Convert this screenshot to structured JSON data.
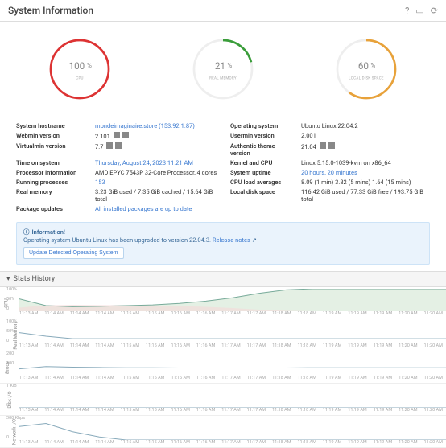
{
  "header": {
    "title": "System Information"
  },
  "gauges": [
    {
      "value": "100",
      "unit": "%",
      "label": "CPU",
      "color": "#d33",
      "pct": 100
    },
    {
      "value": "21",
      "unit": "%",
      "label": "REAL MEMORY",
      "color": "#3a9d3a",
      "pct": 21
    },
    {
      "value": "60",
      "unit": "%",
      "label": "LOCAL DISK SPACE",
      "color": "#e8a23a",
      "pct": 60
    }
  ],
  "info": {
    "hostname_lbl": "System hostname",
    "hostname": "mondeimaginaire.store (153.92.1.87)",
    "os_lbl": "Operating system",
    "os": "Ubuntu Linux 22.04.2",
    "webmin_lbl": "Webmin version",
    "webmin": "2.101",
    "usermin_lbl": "Usermin version",
    "usermin": "2.001",
    "virtualmin_lbl": "Virtualmin version",
    "virtualmin": "7.7",
    "theme_lbl": "Authentic theme version",
    "theme": "21.04",
    "time_lbl": "Time on system",
    "time": "Thursday, August 24, 2023 11:21 AM",
    "kernel_lbl": "Kernel and CPU",
    "kernel": "Linux 5.15.0-1039-kvm on x86_64",
    "proc_lbl": "Processor information",
    "proc": "AMD EPYC 7543P 32-Core Processor, 4 cores",
    "uptime_lbl": "System uptime",
    "uptime": "20 hours, 20 minutes",
    "running_lbl": "Running processes",
    "running": "153",
    "load_lbl": "CPU load averages",
    "load": "8.09 (1 min) 3.82 (5 mins) 1.64 (15 mins)",
    "mem_lbl": "Real memory",
    "mem": "3.23 GiB used / 7.35 GiB cached / 15.64 GiB total",
    "disk_lbl": "Local disk space",
    "disk": "116.42 GiB used / 77.33 GiB free / 193.75 GiB total",
    "pkg_lbl": "Package updates",
    "pkg": "All installed packages are up to date"
  },
  "alert": {
    "title": "Information!",
    "body_pre": "Operating system Ubuntu Linux has been upgraded to version 22.04.3. ",
    "link": "Release notes",
    "button": "Update Detected Operating System"
  },
  "stats": {
    "header": "Stats History",
    "times": [
      "11:13 AM",
      "11:14 AM",
      "11:14 AM",
      "11:14 AM",
      "11:15 AM",
      "11:15 AM",
      "11:16 AM",
      "11:16 AM",
      "11:17 AM",
      "11:17 AM",
      "11:18 AM",
      "11:18 AM",
      "11:19 AM",
      "11:19 AM",
      "11:19 AM",
      "11:20 AM",
      "11:20 AM"
    ],
    "rows": [
      {
        "label": "CPU",
        "y": [
          "100%",
          "50%",
          "0"
        ]
      },
      {
        "label": "Real Memory",
        "y": [
          "100%",
          "50%",
          "0"
        ]
      },
      {
        "label": "Procs",
        "y": [
          "200",
          "100",
          "0"
        ]
      },
      {
        "label": "Disk I/O",
        "y": [
          "1 KiB",
          "0"
        ]
      },
      {
        "label": "Network I/O",
        "y": [
          "300 Kbps",
          "0"
        ]
      }
    ]
  },
  "chart_data": [
    {
      "type": "area",
      "title": "CPU",
      "ylim": [
        0,
        100
      ],
      "x_labels": [
        "11:13",
        "11:14",
        "11:15",
        "11:16",
        "11:17",
        "11:18",
        "11:19",
        "11:20"
      ],
      "values": [
        55,
        25,
        20,
        22,
        25,
        28,
        35,
        45,
        60,
        80,
        95,
        100,
        100,
        100,
        100,
        100,
        100
      ]
    },
    {
      "type": "line",
      "title": "Real Memory",
      "ylim": [
        0,
        100
      ],
      "values": [
        48,
        32,
        21,
        21,
        21,
        21,
        21,
        21,
        21,
        21,
        21,
        21,
        21,
        21,
        21,
        21,
        21
      ]
    },
    {
      "type": "line",
      "title": "Procs",
      "ylim": [
        0,
        200
      ],
      "values": [
        60,
        80,
        75,
        72,
        70,
        70,
        68,
        68,
        68,
        68,
        68,
        70,
        70,
        70,
        70,
        70,
        70
      ]
    },
    {
      "type": "line",
      "title": "Disk I/O",
      "ylim": [
        0,
        1
      ],
      "values": [
        0,
        0,
        0,
        0,
        0,
        0,
        0,
        0,
        0,
        0,
        0,
        0,
        0,
        0,
        0,
        0,
        0
      ]
    },
    {
      "type": "line",
      "title": "Network I/O",
      "ylim": [
        0,
        300
      ],
      "values": [
        180,
        220,
        110,
        40,
        0,
        0,
        0,
        0,
        0,
        0,
        0,
        0,
        0,
        0,
        0,
        0,
        0
      ]
    }
  ]
}
